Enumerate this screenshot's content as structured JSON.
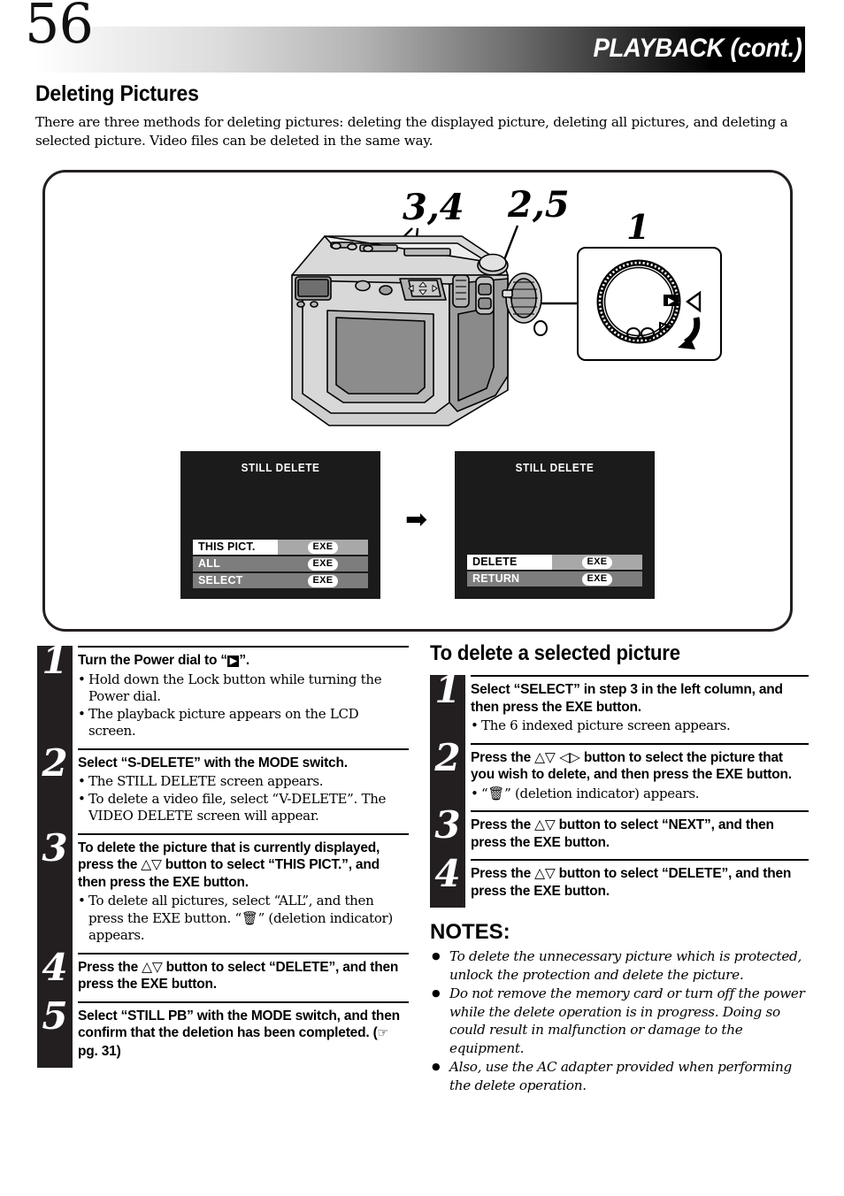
{
  "header": {
    "page_number": "56",
    "title": "PLAYBACK (cont.)"
  },
  "section": {
    "title": "Deleting Pictures",
    "intro": "There are three methods for deleting pictures: deleting the displayed picture, deleting all pictures, and deleting a selected picture. Video files can be deleted in the same way."
  },
  "illustration": {
    "callouts": [
      {
        "label": "3,4",
        "points_to": "arrow-pad-button"
      },
      {
        "label": "2,5",
        "points_to": "mode-switch"
      },
      {
        "label": "1",
        "points_to": "power-dial"
      }
    ],
    "dial_inset": {
      "icons": [
        "playback-icon",
        "pointer-triangle",
        "rotate-arrow"
      ]
    },
    "screens": [
      {
        "title": "STILL DELETE",
        "rows": [
          {
            "label": "THIS PICT.",
            "button": "EXE",
            "selected": true
          },
          {
            "label": "ALL",
            "button": "EXE",
            "selected": false
          },
          {
            "label": "SELECT",
            "button": "EXE",
            "selected": false
          }
        ]
      },
      {
        "title": "STILL DELETE",
        "rows": [
          {
            "label": "DELETE",
            "button": "EXE",
            "selected": true
          },
          {
            "label": "RETURN",
            "button": "EXE",
            "selected": false
          }
        ]
      }
    ],
    "flow_arrow": "➡"
  },
  "left_column": {
    "steps": [
      {
        "num": "1",
        "title_html": "Turn the Power dial to “<span class=\"play-ico\">▶</span>”.",
        "bullets": [
          "Hold down the Lock button while turning the Power dial.",
          "The playback picture appears on the LCD screen."
        ]
      },
      {
        "num": "2",
        "title_html": "Select “S-DELETE” with the MODE switch.",
        "bullets": [
          "The STILL DELETE screen appears.",
          "To delete a video file, select “V-DELETE”. The VIDEO DELETE screen will appear."
        ]
      },
      {
        "num": "3",
        "title_html": "To delete the picture that is currently displayed, press the <span class=\"sym\">△▽</span> button to select “THIS PICT.”, and then press the EXE button.",
        "bullets_html": [
          "To delete all pictures, select “ALL”, and then press the EXE button. “<span class=\"trash\">🗑</span>” (deletion indicator) appears."
        ]
      },
      {
        "num": "4",
        "title_html": "Press the <span class=\"sym\">△▽</span> button to select “DELETE”, and then press the EXE button.",
        "bullets": []
      },
      {
        "num": "5",
        "title_html": "Select “STILL PB” with the MODE switch, and then confirm that the deletion has been completed. (<span class=\"hand\">☞</span> pg. 31)",
        "bullets": []
      }
    ]
  },
  "right_column": {
    "heading": "To delete a selected picture",
    "steps": [
      {
        "num": "1",
        "title_html": "Select “SELECT” in step 3 in the left column, and then press the EXE button.",
        "bullets": [
          "The 6 indexed picture screen appears."
        ]
      },
      {
        "num": "2",
        "title_html": "Press the <span class=\"sym\">△▽ ◁▷</span> button to select the picture that you wish to delete, and then press the EXE button.",
        "bullets_html": [
          "“<span class=\"trash\">🗑</span>” (deletion indicator) appears."
        ]
      },
      {
        "num": "3",
        "title_html": "Press the <span class=\"sym\">△▽</span> button to select “NEXT”, and then press the EXE button.",
        "bullets": []
      },
      {
        "num": "4",
        "title_html": "Press the <span class=\"sym\">△▽</span> button to select “DELETE”, and then press the EXE button.",
        "bullets": []
      }
    ],
    "notes_title": "NOTES:",
    "notes": [
      "To delete the unnecessary picture which is protected, unlock the protection and delete the picture.",
      "Do not remove the memory card or turn off the power while the delete operation is in progress. Doing so could result in malfunction or damage to the equipment.",
      "Also, use the AC adapter provided when performing the delete operation."
    ]
  },
  "colors": {
    "ink": "#231f20",
    "lcd_background": "#1b1b1b",
    "lcd_row": "#7d7d7d",
    "lcd_selected": "#ffffff"
  }
}
